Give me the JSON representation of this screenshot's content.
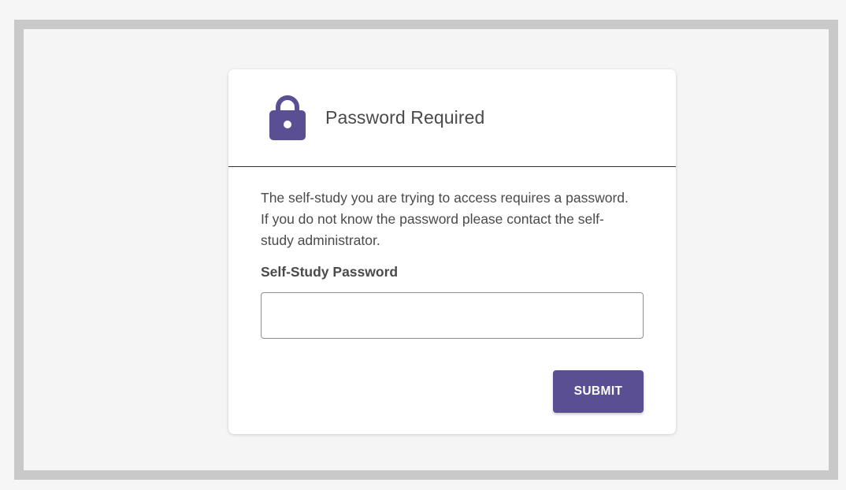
{
  "dialog": {
    "title": "Password Required",
    "icon": "lock-icon",
    "description": "The self-study you are trying to access requires a password. If you do not know the password please contact the self-study administrator.",
    "password_label": "Self-Study Password",
    "password_value": "",
    "password_placeholder": "",
    "submit_label": "SUBMIT"
  },
  "colors": {
    "accent": "#5a4f93",
    "text": "#4a4a4a",
    "frame": "#c9c9c9",
    "background": "#f5f5f5"
  }
}
